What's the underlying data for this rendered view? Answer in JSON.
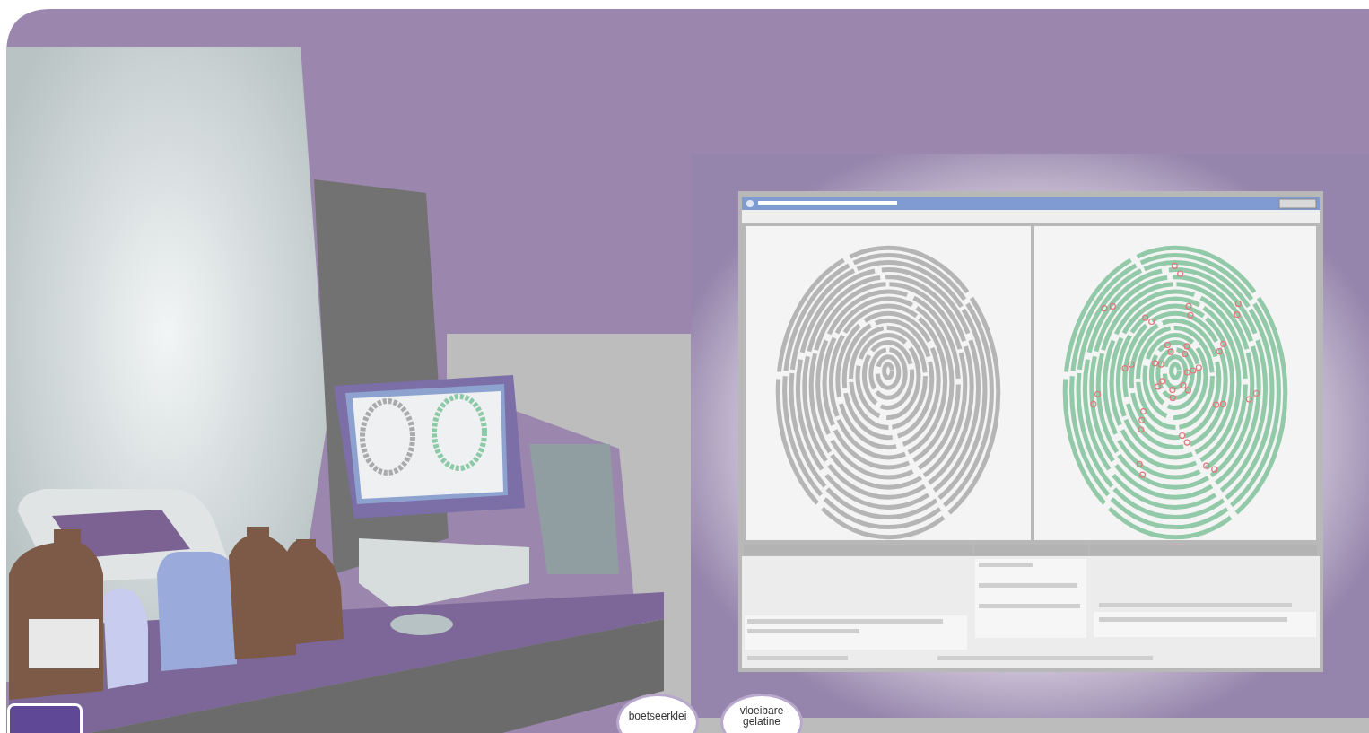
{
  "choices": [
    {
      "label": "boetseerklei"
    },
    {
      "label": "vloeibare gelatine"
    }
  ]
}
